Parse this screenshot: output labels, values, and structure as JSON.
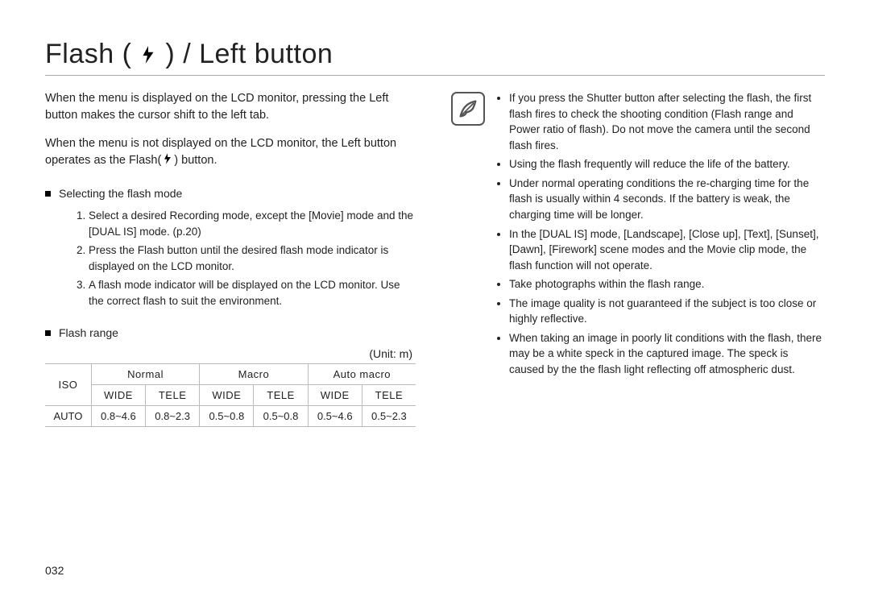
{
  "title": {
    "pre": "Flash (",
    "post": ") / Left button"
  },
  "left": {
    "para1": "When the menu is displayed on the LCD monitor, pressing the Left button makes the cursor shift to the left tab.",
    "para2_pre": "When the menu is not displayed on the LCD monitor, the Left button operates as the Flash(",
    "para2_post": ") button.",
    "section1": "Selecting the flash mode",
    "steps": [
      "Select a desired Recording mode, except the [Movie] mode and the [DUAL IS] mode. (p.20)",
      "Press the Flash button until the desired flash mode indicator is displayed on the LCD monitor.",
      "A flash mode indicator will be displayed on the LCD monitor. Use the correct flash to suit the environment."
    ],
    "section2": "Flash range",
    "unit": "(Unit: m)",
    "table": {
      "iso": "ISO",
      "groups": [
        "Normal",
        "Macro",
        "Auto macro"
      ],
      "subs": [
        "WIDE",
        "TELE",
        "WIDE",
        "TELE",
        "WIDE",
        "TELE"
      ],
      "row_label": "AUTO",
      "row": [
        "0.8~4.6",
        "0.8~2.3",
        "0.5~0.8",
        "0.5~0.8",
        "0.5~4.6",
        "0.5~2.3"
      ]
    }
  },
  "notes": [
    "If you press the Shutter button after selecting the flash, the first flash fires to check the shooting condition (Flash range and Power ratio of flash). Do not move the camera until the second flash fires.",
    "Using the flash frequently will reduce the life of the battery.",
    "Under normal operating conditions the re-charging time for the flash is usually within 4 seconds. If the battery is weak, the charging time will be longer.",
    "In the [DUAL IS] mode, [Landscape], [Close up], [Text], [Sunset], [Dawn], [Firework] scene modes and the Movie clip mode, the flash function will not operate.",
    "Take photographs within the flash range.",
    "The image quality is not guaranteed if the subject is too close or highly reflective.",
    "When taking an image in poorly lit conditions with the flash, there may be a white speck in the captured image. The speck is caused by the the flash light reflecting off atmospheric dust."
  ],
  "page": "032"
}
